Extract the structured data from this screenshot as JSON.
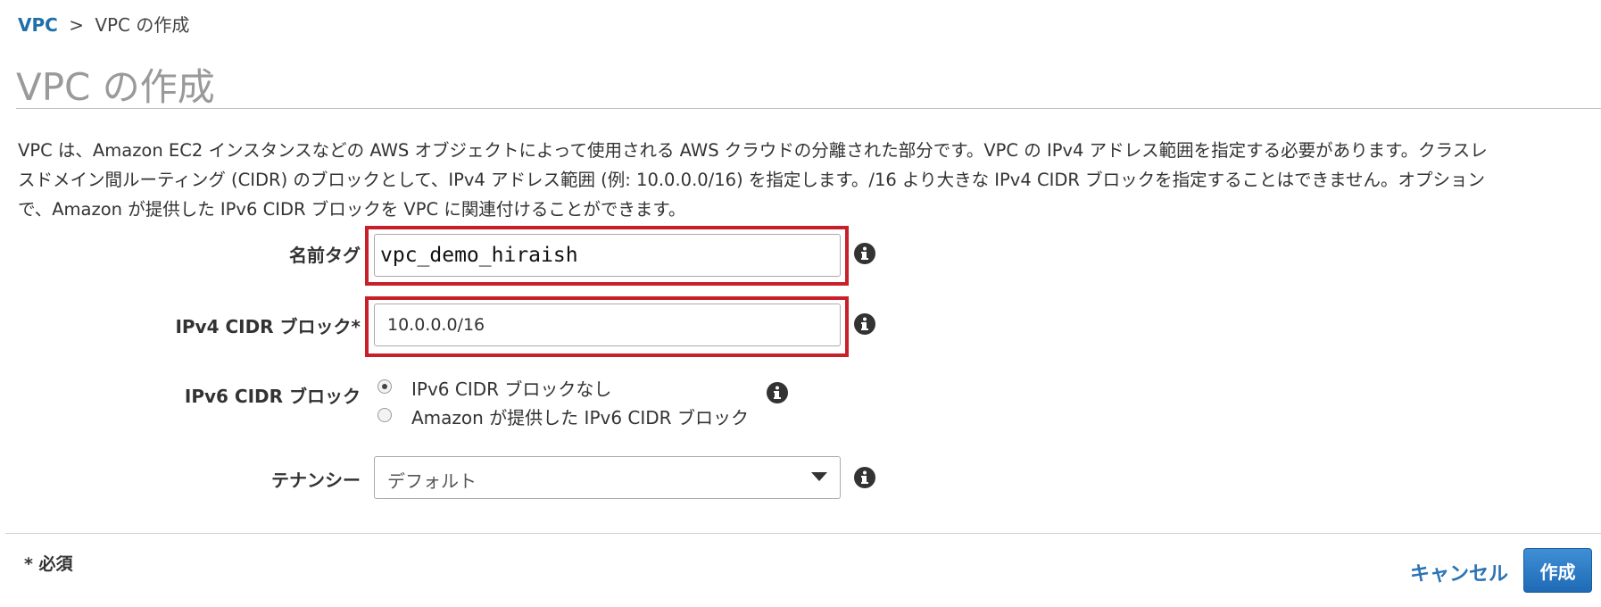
{
  "breadcrumb": {
    "root": "VPC",
    "separator": ">",
    "current": "VPC の作成"
  },
  "page": {
    "title": "VPC の作成"
  },
  "description": {
    "lines": [
      "VPC は、Amazon EC2 インスタンスなどの AWS オブジェクトによって使用される AWS クラウドの分離された部分です。VPC の IPv4 アドレス範囲を指定する必要があります。クラスレ",
      "スドメイン間ルーティング (CIDR) のブロックとして、IPv4 アドレス範囲 (例: 10.0.0.0/16) を指定します。/16 より大きな IPv4 CIDR ブロックを指定することはできません。オプション",
      "で、Amazon が提供した IPv6 CIDR ブロックを VPC に関連付けることができます。"
    ]
  },
  "form": {
    "name_tag": {
      "label": "名前タグ",
      "value": "vpc_demo_hiraish",
      "info_icon": "info-icon"
    },
    "ipv4_cidr": {
      "label": "IPv4 CIDR ブロック*",
      "value": "10.0.0.0/16",
      "info_icon": "info-icon"
    },
    "ipv6_cidr": {
      "label": "IPv6 CIDR ブロック",
      "options": [
        {
          "label": "IPv6 CIDR ブロックなし",
          "selected": true
        },
        {
          "label": "Amazon が提供した IPv6 CIDR ブロック",
          "selected": false
        }
      ],
      "info_icon": "info-icon"
    },
    "tenancy": {
      "label": "テナンシー",
      "selected": "デフォルト",
      "info_icon": "info-icon"
    }
  },
  "footer": {
    "required_note": "* 必須",
    "cancel_label": "キャンセル",
    "create_label": "作成"
  },
  "colors": {
    "link": "#1f6fa8",
    "highlight_border": "#c8202a",
    "primary_button": "#2a7cc7",
    "title_gray": "#9a9a9a"
  }
}
